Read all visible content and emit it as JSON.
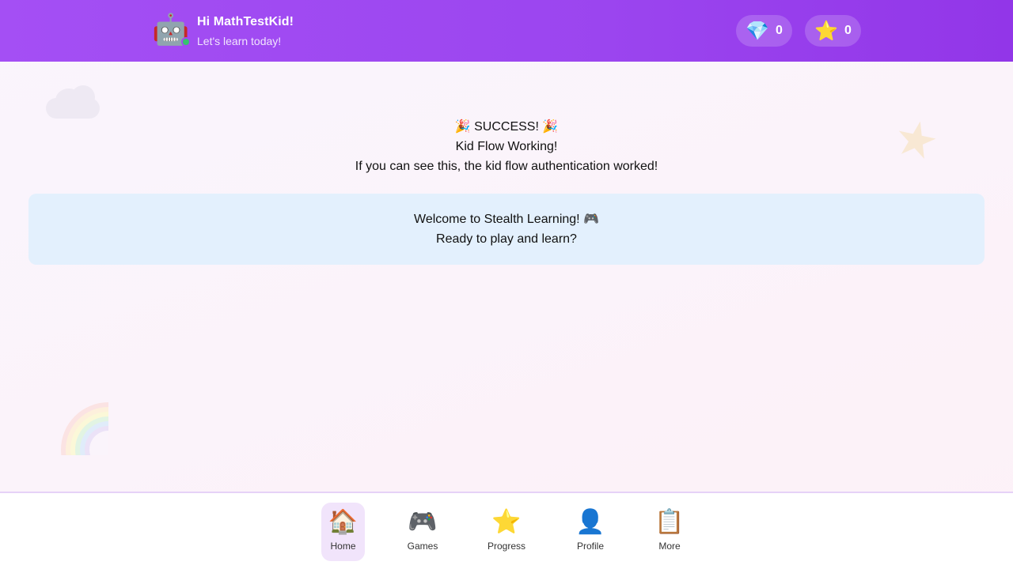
{
  "header": {
    "greeting": "Hi MathTestKid!",
    "subtitle": "Let's learn today!",
    "avatar_icon": "🤖",
    "gems": {
      "icon": "💎",
      "value": "0"
    },
    "stars": {
      "icon": "⭐",
      "value": "0"
    }
  },
  "main": {
    "success_title": "🎉 SUCCESS! 🎉",
    "success_subtitle": "Kid Flow Working!",
    "success_message": "If you can see this, the kid flow authentication worked!",
    "welcome_line1": "Welcome to Stealth Learning! 🎮",
    "welcome_line2": "Ready to play and learn?"
  },
  "decorations": {
    "star_icon": "★",
    "rainbow_colors": [
      "#fbe3e3",
      "#fdf0dc",
      "#fbf8d8",
      "#e2f4e3",
      "#e0ecfa",
      "#ebe2f7"
    ]
  },
  "nav": {
    "active": "home",
    "items": [
      {
        "id": "home",
        "icon": "🏠",
        "label": "Home"
      },
      {
        "id": "games",
        "icon": "🎮",
        "label": "Games"
      },
      {
        "id": "progress",
        "icon": "⭐",
        "label": "Progress"
      },
      {
        "id": "profile",
        "icon": "👤",
        "label": "Profile"
      },
      {
        "id": "more",
        "icon": "📋",
        "label": "More"
      }
    ]
  },
  "colors": {
    "header_start": "#a44ff4",
    "header_end": "#9236e8",
    "card_bg": "#e3f0fd",
    "active_nav_bg": "#f1e4fb"
  }
}
